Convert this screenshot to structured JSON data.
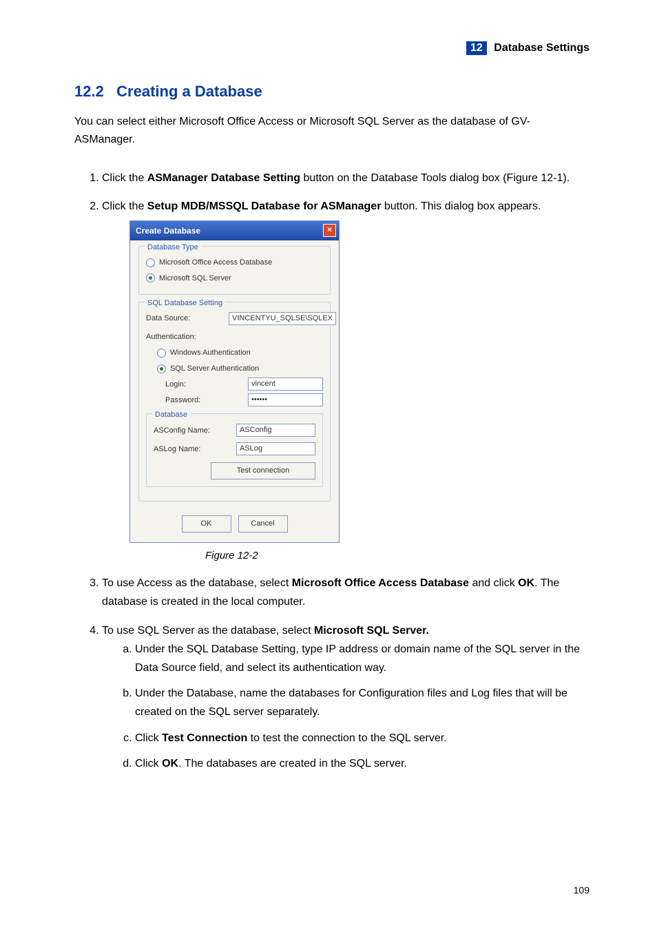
{
  "header": {
    "chapter_num": "12",
    "chapter_title": "Database  Settings"
  },
  "section": {
    "number": "12.2",
    "title": "Creating a Database"
  },
  "intro": "You can select either Microsoft Office Access or Microsoft SQL Server as the database of GV-ASManager.",
  "steps": {
    "s1_a": "Click the ",
    "s1_b": "ASManager Database Setting",
    "s1_c": " button on the Database Tools dialog box (Figure 12-1).",
    "s2_a": "Click the ",
    "s2_b": "Setup MDB/MSSQL Database for ASManager",
    "s2_c": " button. This dialog box appears.",
    "s3_a": "To use Access as the database, select ",
    "s3_b": "Microsoft Office Access Database",
    "s3_c": " and click ",
    "s3_d": "OK",
    "s3_e": ". The database is created in the local computer.",
    "s4_a": "To use SQL Server as the database, select ",
    "s4_b": "Microsoft SQL Server."
  },
  "substeps": {
    "a": "Under the SQL Database Setting, type IP address or domain name of the SQL server in the Data Source field, and select its authentication way.",
    "b": "Under the Database, name the databases for Configuration files and Log files that will be created on the SQL server separately.",
    "c_a": "Click ",
    "c_b": "Test Connection",
    "c_c": " to test the connection to the SQL server.",
    "d_a": "Click ",
    "d_b": "OK",
    "d_c": ". The databases are created in the SQL server."
  },
  "dialog": {
    "title": "Create Database",
    "grp_type": "Database Type",
    "opt_access": "Microsoft Office Access Database",
    "opt_mssql": "Microsoft SQL Server",
    "grp_sql": "SQL Database Setting",
    "lbl_datasource": "Data Source:",
    "val_datasource": "VINCENTYU_SQLSE\\SQLEX",
    "lbl_auth": "Authentication:",
    "opt_winauth": "Windows Authentication",
    "opt_sqlauth": "SQL Server Authentication",
    "lbl_login": "Login:",
    "val_login": "vincent",
    "lbl_password": "Password:",
    "val_password": "••••••",
    "grp_db": "Database",
    "lbl_asconfig": "ASConfig Name:",
    "val_asconfig": "ASConfig",
    "lbl_aslog": "ASLog Name:",
    "val_aslog": "ASLog",
    "btn_test": "Test connection",
    "btn_ok": "OK",
    "btn_cancel": "Cancel"
  },
  "figure_caption": "Figure 12-2",
  "page_number": "109"
}
